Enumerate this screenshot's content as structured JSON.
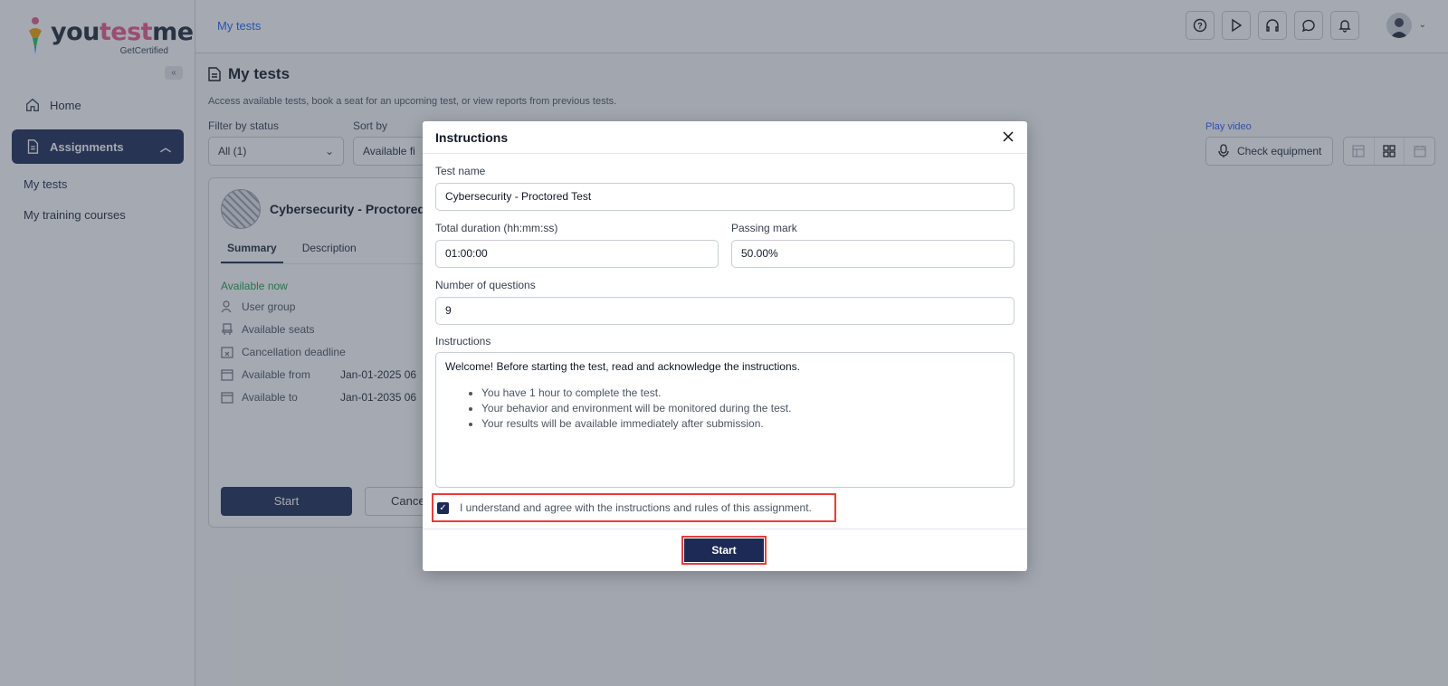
{
  "brand": {
    "name_part1": "you",
    "name_part2": "test",
    "name_part3": "me",
    "tagline": "GetCertified"
  },
  "sidebar": {
    "collapse_glyph": "«",
    "home": "Home",
    "assignments": "Assignments",
    "sub_items": [
      "My tests",
      "My training courses"
    ]
  },
  "topbar": {
    "breadcrumb": "My tests"
  },
  "page": {
    "title": "My tests",
    "subtitle": "Access available tests, book a seat for an upcoming test, or view reports from previous tests.",
    "filter_label": "Filter by status",
    "filter_value": "All (1)",
    "sort_label": "Sort by",
    "sort_value": "Available fi",
    "play_video": "Play video",
    "check_equipment": "Check equipment"
  },
  "card": {
    "title": "Cybersecurity - Proctored",
    "tabs": [
      "Summary",
      "Description"
    ],
    "status": "Available now",
    "rows": [
      {
        "label": "User group",
        "value": ""
      },
      {
        "label": "Available seats",
        "value": ""
      },
      {
        "label": "Cancellation deadline",
        "value": ""
      },
      {
        "label": "Available from",
        "value": "Jan-01-2025 06"
      },
      {
        "label": "Available to",
        "value": "Jan-01-2035 06"
      }
    ],
    "start": "Start",
    "cancel": "Cance"
  },
  "modal": {
    "title": "Instructions",
    "test_name_label": "Test name",
    "test_name": "Cybersecurity - Proctored Test",
    "duration_label": "Total duration (hh:mm:ss)",
    "duration": "01:00:00",
    "passing_label": "Passing mark",
    "passing": "50.00%",
    "questions_label": "Number of questions",
    "questions": "9",
    "instructions_label": "Instructions",
    "intro": "Welcome! Before starting the test, read and acknowledge the instructions.",
    "bullets": [
      "You have 1 hour to complete the test.",
      "Your behavior and environment will be monitored during the test.",
      "Your results will be available immediately after submission."
    ],
    "agree_text": "I understand and agree with the instructions and rules of this assignment.",
    "agree_checked": true,
    "start": "Start"
  },
  "colors": {
    "primary": "#1c2a55",
    "link": "#2563eb",
    "success": "#16a34a",
    "highlight": "#e53e3e"
  }
}
